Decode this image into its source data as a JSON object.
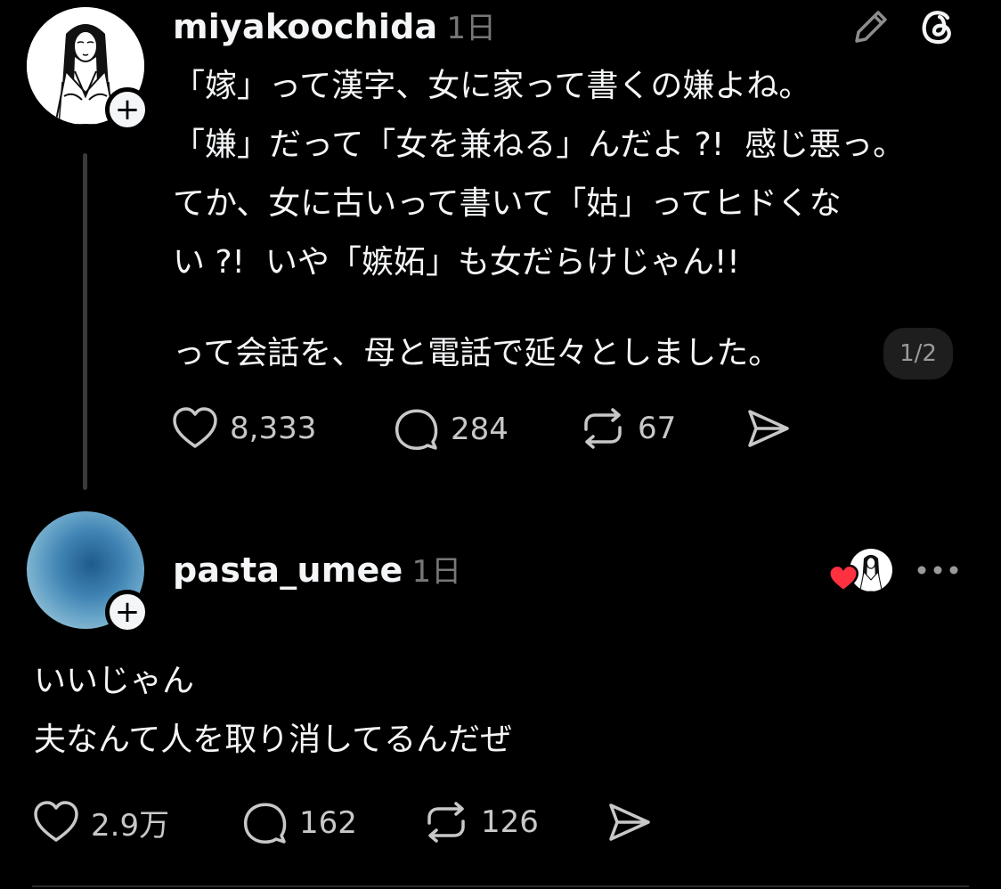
{
  "post1": {
    "username": "miyakoochida",
    "time": "1日",
    "lines": [
      "「嫁」って漢字、女に家って書くの嫌よね。",
      "「嫌」だって「女を兼ねる」んだよ ?!  感じ悪っ。",
      "てか、女に古いって書いて「姑」ってヒドくな",
      "い ?!  いや「嫉妬」も女だらけじゃん!!"
    ],
    "last_line": "って会話を、母と電話で延々としました。",
    "pager": "1/2",
    "likes": "8,333",
    "replies": "284",
    "reposts": "67"
  },
  "post2": {
    "username": "pasta_umee",
    "time": "1日",
    "lines": [
      "いいじゃん",
      "夫なんて人を取り消してるんだぜ"
    ],
    "likes": "2.9万",
    "replies": "162",
    "reposts": "126"
  },
  "icons": {
    "edit": "pencil-icon",
    "threads": "threads-logo-icon",
    "like": "heart-icon",
    "reply": "comment-icon",
    "repost": "repost-icon",
    "share": "send-icon",
    "more": "more-icon",
    "liked_by_author": "heart-red-icon"
  },
  "colors": {
    "background": "#000000",
    "text": "#f3f5f7",
    "muted": "#777777",
    "heart_red": "#ff3040"
  }
}
